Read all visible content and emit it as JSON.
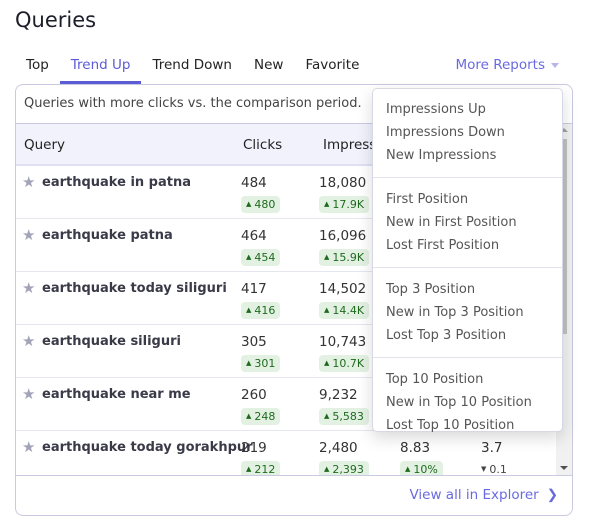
{
  "title": "Queries",
  "tabs": [
    {
      "label": "Top"
    },
    {
      "label": "Trend Up"
    },
    {
      "label": "Trend Down"
    },
    {
      "label": "New"
    },
    {
      "label": "Favorite"
    }
  ],
  "active_tab": "Trend Up",
  "more_reports": "More Reports",
  "description": "Queries with more clicks vs. the comparison period.",
  "columns": {
    "query": "Query",
    "clicks": "Clicks",
    "impressions": "Impressions"
  },
  "rows": [
    {
      "query": "earthquake in patna",
      "clicks": "484",
      "clicks_delta": "480",
      "impressions": "18,080",
      "impressions_delta": "17.9K"
    },
    {
      "query": "earthquake patna",
      "clicks": "464",
      "clicks_delta": "454",
      "impressions": "16,096",
      "impressions_delta": "15.9K"
    },
    {
      "query": "earthquake today siliguri",
      "clicks": "417",
      "clicks_delta": "416",
      "impressions": "14,502",
      "impressions_delta": "14.4K"
    },
    {
      "query": "earthquake siliguri",
      "clicks": "305",
      "clicks_delta": "301",
      "impressions": "10,743",
      "impressions_delta": "10.7K"
    },
    {
      "query": "earthquake near me",
      "clicks": "260",
      "clicks_delta": "248",
      "impressions": "9,232",
      "impressions_delta": "5,583"
    },
    {
      "query": "earthquake today gorakhpur",
      "clicks": "219",
      "clicks_delta": "212",
      "impressions": "2,480",
      "impressions_delta": "2,393",
      "ctr": "8.83",
      "ctr_delta": "10%",
      "position": "3.7",
      "position_delta": "0.1"
    }
  ],
  "menu": [
    [
      "Impressions Up",
      "Impressions Down",
      "New Impressions"
    ],
    [
      "First Position",
      "New in First Position",
      "Lost First Position"
    ],
    [
      "Top 3 Position",
      "New in Top 3 Position",
      "Lost Top 3 Position"
    ],
    [
      "Top 10 Position",
      "New in Top 10 Position",
      "Lost Top 10 Position"
    ]
  ],
  "footer_link": "View all in Explorer",
  "colors": {
    "accent": "#5b5bd6",
    "positive_bg": "#e3f1e3",
    "positive_text": "#1f6a1f"
  }
}
